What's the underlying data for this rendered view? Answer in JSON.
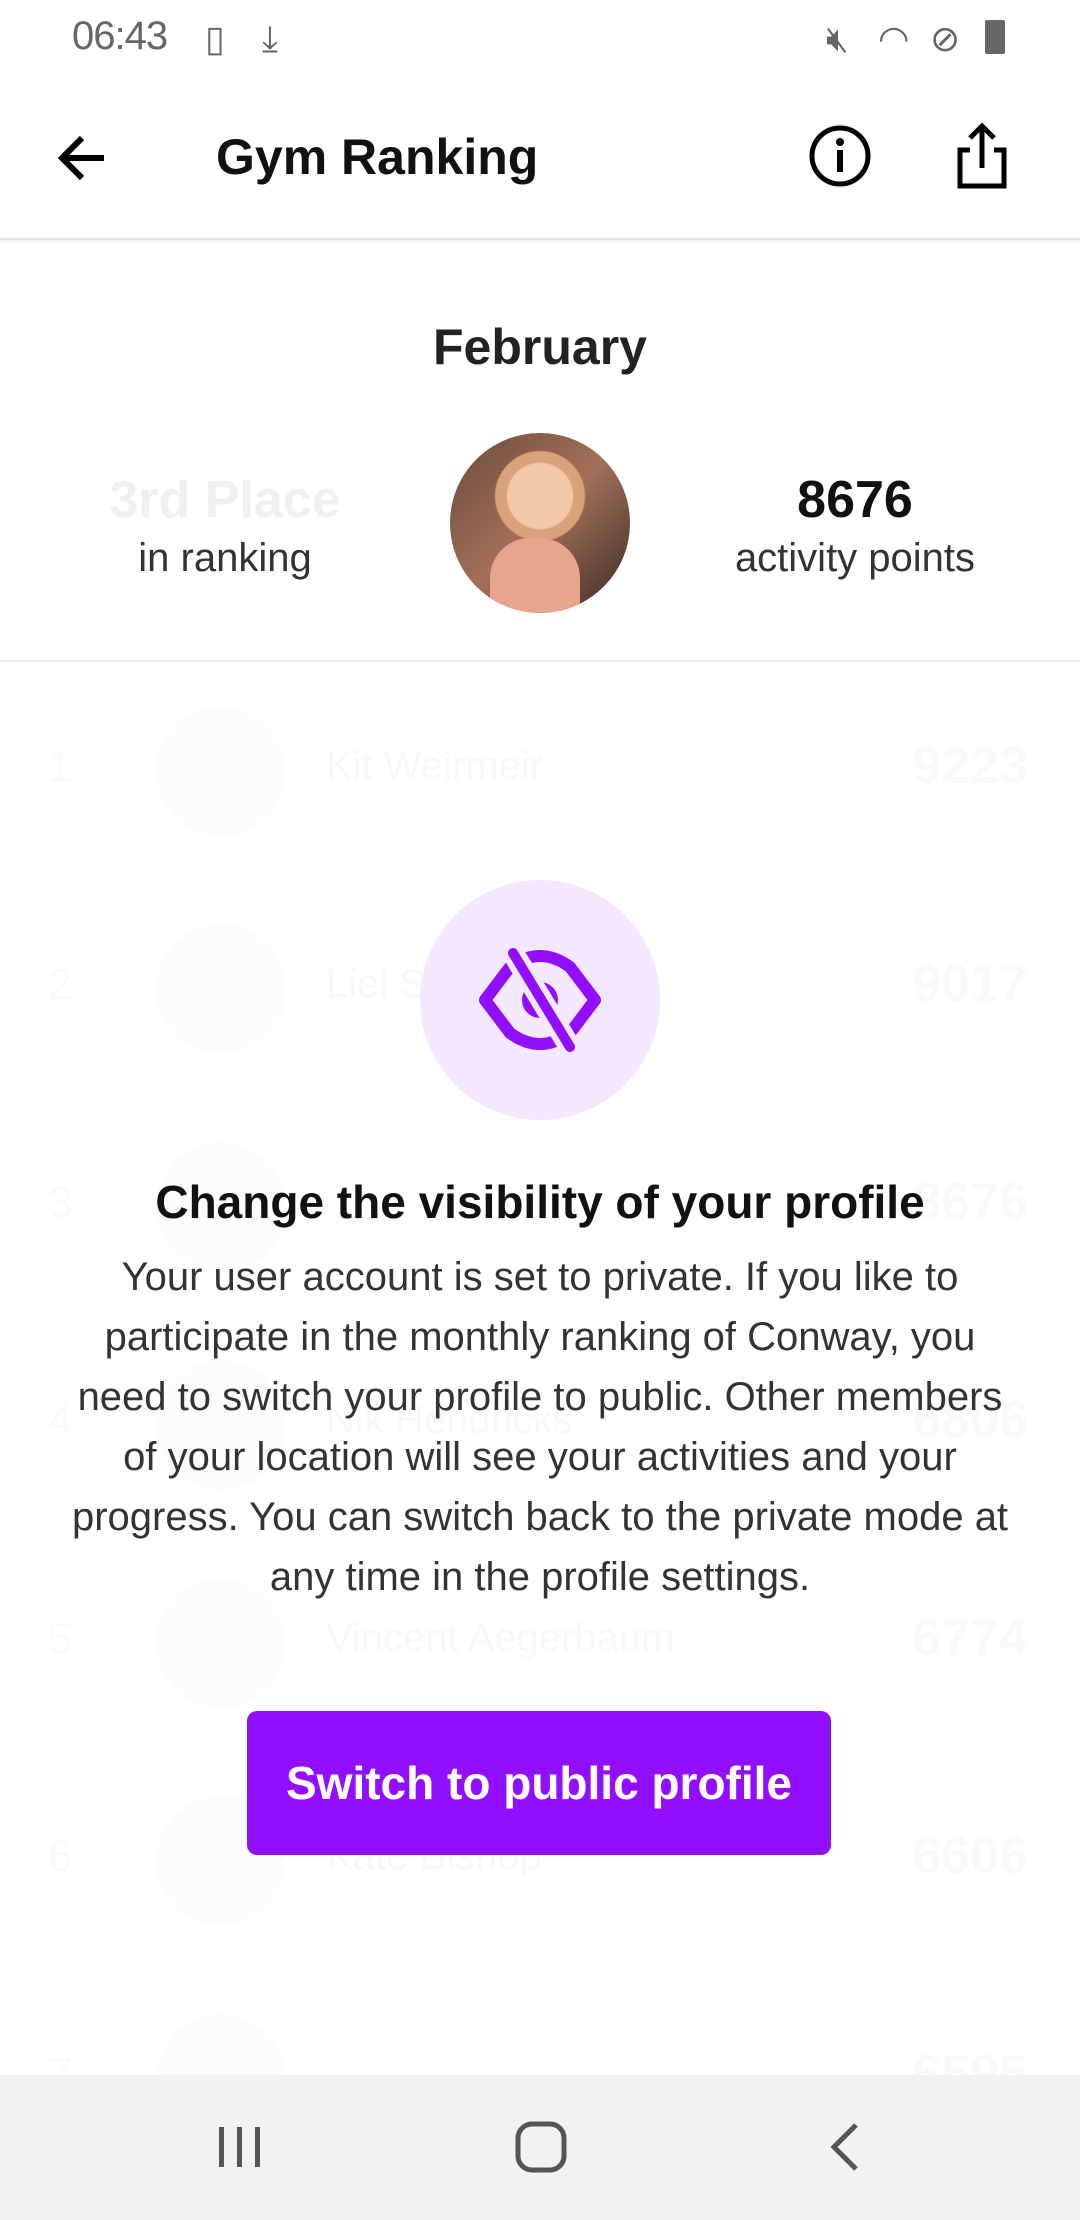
{
  "status_bar": {
    "time": "06:43",
    "icons": [
      "screenshot-check-icon",
      "download-icon",
      "mute-icon",
      "wifi-icon",
      "do-not-disturb-icon",
      "battery-icon"
    ]
  },
  "app_bar": {
    "title": "Gym Ranking",
    "icons": [
      "back-arrow-icon",
      "info-icon",
      "share-icon"
    ]
  },
  "summary": {
    "month": "February",
    "place": "3rd Place",
    "place_label": "in ranking",
    "points": "8676",
    "points_label": "activity points"
  },
  "ranking": [
    {
      "rank": "1",
      "name": "Kit Weirmeir",
      "points": "9223"
    },
    {
      "rank": "2",
      "name": "Liel S",
      "points": "9017"
    },
    {
      "rank": "3",
      "name": "",
      "points": "8676"
    },
    {
      "rank": "4",
      "name": "Nik Hendricks",
      "points": "6806"
    },
    {
      "rank": "5",
      "name": "Vincent Aegerbaum",
      "points": "6774"
    },
    {
      "rank": "6",
      "name": "Kate Bishop",
      "points": "6606"
    },
    {
      "rank": "7",
      "name": "",
      "points": "6595"
    }
  ],
  "dialog": {
    "icon": "eye-off-icon",
    "title": "Change the visibility of your profile",
    "body": "Your user account is set to private. If you like to participate in the monthly ranking of Conway, you need to switch your profile to public. Other members of your location will see your activities and your progress. You can switch back to the private mode at any time in the profile settings.",
    "button": "Switch to public profile"
  },
  "colors": {
    "accent": "#910ffe",
    "icon_bg": "#f3e8ff"
  },
  "nav_bar": {
    "icons": [
      "recents-icon",
      "home-icon",
      "back-icon"
    ]
  }
}
